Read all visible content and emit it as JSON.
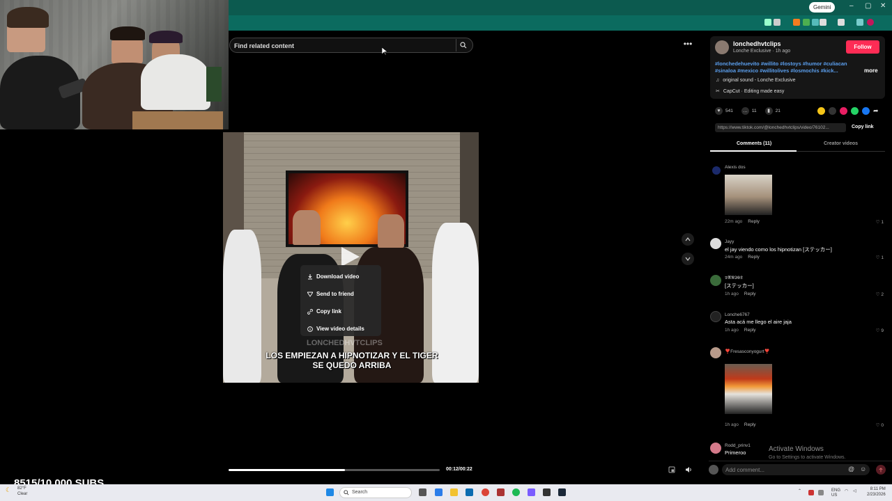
{
  "browser": {
    "gemini_label": "Gemini",
    "window_controls": [
      "–",
      "▢",
      "✕"
    ]
  },
  "search": {
    "placeholder": "Find related content"
  },
  "video": {
    "watermark": "LONCHEDHVTCLIPS",
    "caption": "LOS EMPIEZAN A HIPNOTIZAR Y EL TIGER SE QUEDO ARRIBA",
    "time": "00:12/00:22",
    "progress": 0.55
  },
  "context_menu": {
    "items": [
      {
        "label": "Download video",
        "icon": "download-icon"
      },
      {
        "label": "Send to friend",
        "icon": "send-icon"
      },
      {
        "label": "Copy link",
        "icon": "link-icon"
      },
      {
        "label": "View video details",
        "icon": "info-icon"
      }
    ]
  },
  "overlay": {
    "subs": "8515/10,000 SUBS"
  },
  "post": {
    "username": "lonchedhvtclips",
    "sub_line": "Lonche Exclusive · 1h ago",
    "follow_label": "Follow",
    "hashtags": "#lonchedehuevito #willito #lostoys #humor #culiacan #sinaloa #mexico #willitolives #losmochis #kick...",
    "more_label": "more",
    "sound": "original sound - Lonche Exclusive",
    "capcut": "CapCut · Editing made easy",
    "likes": "541",
    "comments_count": "11",
    "saves": "21",
    "url": "https://www.tiktok.com/@lonchedhvtclips/video/76102...",
    "copy_link_label": "Copy link"
  },
  "tabs": {
    "comments": "Comments (11)",
    "creator": "Creator videos"
  },
  "comments": [
    {
      "name": "Alexis dos",
      "text": "",
      "time": "22m ago",
      "reply": "Reply",
      "likes": "1",
      "has_image": true
    },
    {
      "name": "Jayy",
      "text": "el jay viendo como los hipnotizan [ステッカー]",
      "time": "24m ago",
      "reply": "Reply",
      "likes": "1"
    },
    {
      "name": "𝕯𝕬𝕹𝕴𝕰𝕷",
      "text": "[ステッカー]",
      "time": "1h ago",
      "reply": "Reply",
      "likes": "2"
    },
    {
      "name": "Lonche6767",
      "text": "Asta acá me llego el aire jaja",
      "time": "1h ago",
      "reply": "Reply",
      "likes": "9"
    },
    {
      "name": "❣️Fresasconyogurt❣️",
      "text": "",
      "time": "1h ago",
      "reply": "Reply",
      "likes": "0",
      "has_image": true
    },
    {
      "name": "Rodd_prinv1",
      "text": "Primeroo",
      "time": "",
      "reply": "",
      "likes": ""
    }
  ],
  "windows": {
    "activate_title": "Activate Windows",
    "activate_sub": "Go to Settings to activate Windows."
  },
  "comment_input": {
    "placeholder": "Add comment..."
  },
  "taskbar": {
    "temp": "82°F",
    "weather": "Clear",
    "search_label": "Search",
    "lang": "ENG",
    "region": "US",
    "time": "8:11 PM",
    "date": "2/23/2026"
  },
  "colors": {
    "accent": "#fe2c55",
    "hashtag": "#5b9fee",
    "browser_bar": "#0c5a4f"
  }
}
